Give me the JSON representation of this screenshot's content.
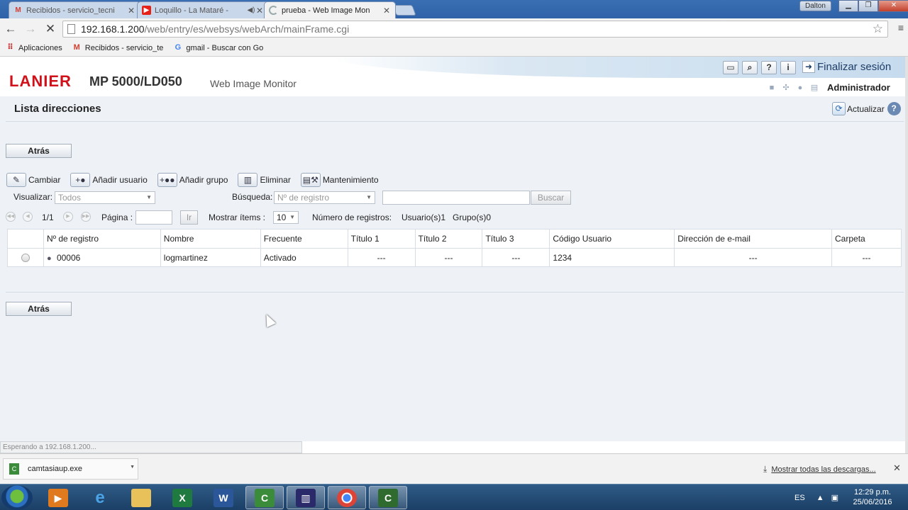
{
  "browser": {
    "tabs": [
      {
        "title": "Recibidos - servicio_tecni",
        "icon": "gmail-icon"
      },
      {
        "title": "Loquillo - La Mataré -",
        "icon": "youtube-icon"
      },
      {
        "title": "prueba - Web Image Mon",
        "icon": "loading-icon"
      }
    ],
    "profile": "Dalton",
    "url_host": "192.168.1.200",
    "url_path": "/web/entry/es/websys/webArch/mainFrame.cgi",
    "bookmarks": [
      {
        "label": "Aplicaciones",
        "icon": "apps-icon"
      },
      {
        "label": "Recibidos - servicio_te",
        "icon": "gmail-icon"
      },
      {
        "label": "gmail - Buscar con Go",
        "icon": "google-icon"
      }
    ]
  },
  "header": {
    "brand": "LANIER",
    "model": "MP 5000/LD050",
    "product": "Web Image Monitor",
    "logout_label": "Finalizar sesión",
    "user": "Administrador"
  },
  "page": {
    "title": "Lista direcciones",
    "refresh_label": "Actualizar",
    "back_label": "Atrás",
    "actions": [
      {
        "label": "Cambiar",
        "icon": "pencil-icon"
      },
      {
        "label": "Añadir usuario",
        "icon": "add-user-icon"
      },
      {
        "label": "Añadir grupo",
        "icon": "add-group-icon"
      },
      {
        "label": "Eliminar",
        "icon": "trash-icon"
      },
      {
        "label": "Mantenimiento",
        "icon": "maintenance-icon"
      }
    ],
    "filters": {
      "view_label": "Visualizar:",
      "view_value": "Todos",
      "search_label": "Búsqueda:",
      "search_field": "Nº de registro",
      "search_text": "",
      "search_button": "Buscar"
    },
    "pager": {
      "page_info": "1/1",
      "page_label": "Página :",
      "page_input": "",
      "go_button": "Ir",
      "items_label": "Mostrar ítems :",
      "items_value": "10",
      "records_label": "Número de registros:",
      "users": "Usuario(s)1",
      "groups": "Grupo(s)0"
    },
    "table": {
      "columns": [
        "Nº de registro",
        "Nombre",
        "Frecuente",
        "Título 1",
        "Título 2",
        "Título 3",
        "Código Usuario",
        "Dirección de e-mail",
        "Carpeta"
      ],
      "rows": [
        {
          "reg": "00006",
          "name": "logmartinez",
          "freq": "Activado",
          "t1": "---",
          "t2": "---",
          "t3": "---",
          "code": "1234",
          "email": "---",
          "folder": "---"
        }
      ]
    }
  },
  "status_text": "Esperando a 192.168.1.200...",
  "downloads": {
    "file": "camtasiaup.exe",
    "show_all": "Mostrar todas las descargas..."
  },
  "taskbar": {
    "lang": "ES",
    "time": "12:29 p.m.",
    "date": "25/06/2016"
  }
}
